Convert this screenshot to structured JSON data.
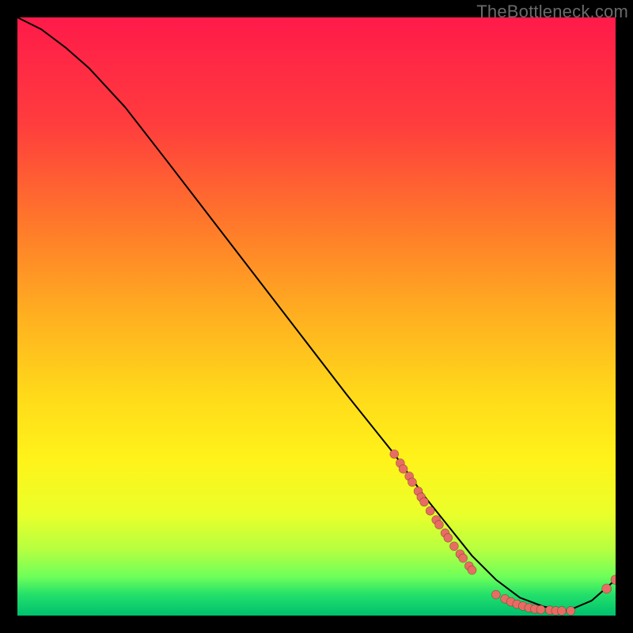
{
  "watermark": "TheBottleneck.com",
  "colors": {
    "dot_fill": "#e86c63",
    "curve_stroke": "#000000",
    "page_bg": "#000000"
  },
  "chart_data": {
    "type": "line",
    "title": "",
    "xlabel": "",
    "ylabel": "",
    "xlim": [
      0,
      100
    ],
    "ylim": [
      0,
      100
    ],
    "grid": false,
    "legend": false,
    "curve": {
      "x": [
        0,
        4,
        8,
        12,
        18,
        25,
        35,
        45,
        55,
        63,
        68,
        72,
        76,
        80,
        84,
        88,
        92,
        96,
        100
      ],
      "y": [
        100,
        98,
        95,
        91.5,
        85,
        76,
        63,
        50,
        37,
        27,
        20,
        15,
        10,
        6,
        3,
        1.5,
        0.8,
        2.5,
        6
      ]
    },
    "scatter_series": [
      {
        "name": "left-descent-cluster",
        "x": [
          63,
          64,
          64.5,
          65.5,
          66,
          67,
          67.5,
          68,
          69,
          70,
          70.5,
          71.5,
          72
        ],
        "y": [
          27,
          25.5,
          24.5,
          23.3,
          22.3,
          20.8,
          19.8,
          19,
          17.5,
          16,
          15.2,
          13.8,
          13
        ],
        "r": 5.5
      },
      {
        "name": "mid-descent-cluster",
        "x": [
          73,
          74,
          74.5,
          75.5,
          76
        ],
        "y": [
          11.6,
          10.3,
          9.6,
          8.3,
          7.6
        ],
        "r": 5.5
      },
      {
        "name": "valley-cluster",
        "x": [
          80,
          81.5,
          82.5,
          83.5,
          84.5,
          85.5,
          86.5,
          87.5,
          89,
          90,
          91,
          92.5
        ],
        "y": [
          3.5,
          2.8,
          2.3,
          1.9,
          1.6,
          1.3,
          1.1,
          1.0,
          0.9,
          0.8,
          0.8,
          0.8
        ],
        "r": 5.5
      },
      {
        "name": "upturn-point",
        "x": [
          98.5
        ],
        "y": [
          4.5
        ],
        "r": 6
      },
      {
        "name": "corner-point",
        "x": [
          100
        ],
        "y": [
          6
        ],
        "r": 6
      }
    ]
  }
}
